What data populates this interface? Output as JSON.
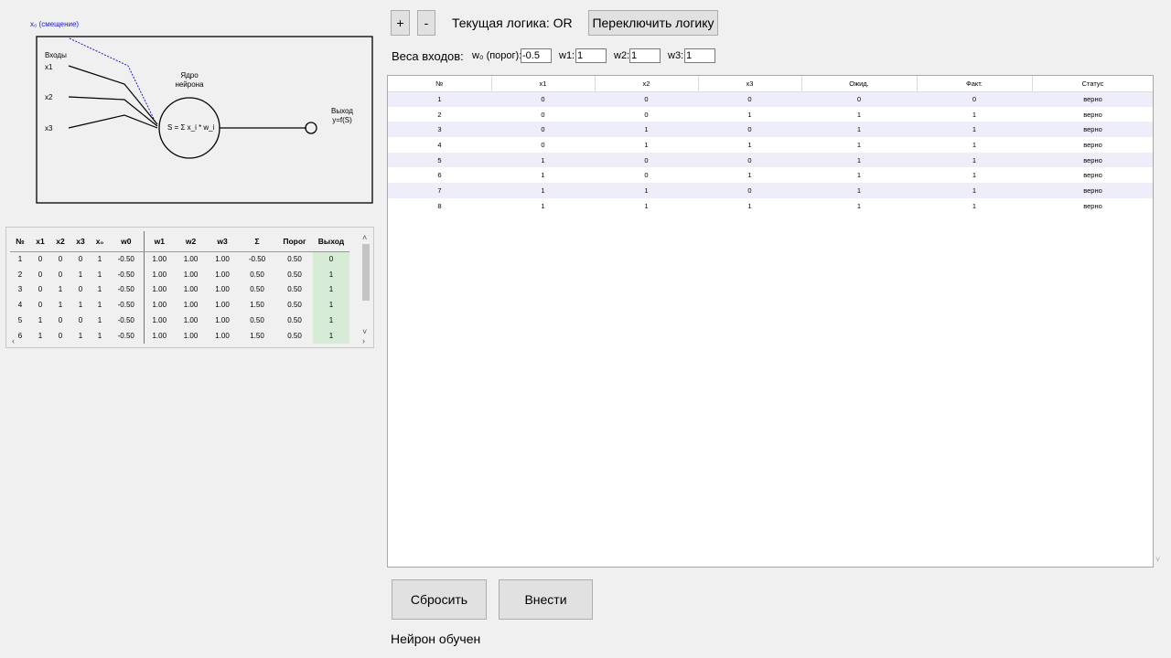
{
  "diagram": {
    "bias_label": "x₀ (смещение)",
    "inputs_label": "Входы",
    "input_names": [
      "x1",
      "x2",
      "x3"
    ],
    "core_label_line1": "Ядро",
    "core_label_line2": "нейрона",
    "sum_formula": "S = Σ x_i * w_i",
    "output_label_line1": "Выход",
    "output_label_line2": "y=f(S)"
  },
  "calc_table": {
    "headers": [
      "№",
      "x1",
      "x2",
      "x3",
      "x₀",
      "w0",
      "w1",
      "w2",
      "w3",
      "Σ",
      "Порог",
      "Выход"
    ],
    "rows": [
      [
        "1",
        "0",
        "0",
        "0",
        "1",
        "-0.50",
        "1.00",
        "1.00",
        "1.00",
        "-0.50",
        "0.50",
        "0"
      ],
      [
        "2",
        "0",
        "0",
        "1",
        "1",
        "-0.50",
        "1.00",
        "1.00",
        "1.00",
        "0.50",
        "0.50",
        "1"
      ],
      [
        "3",
        "0",
        "1",
        "0",
        "1",
        "-0.50",
        "1.00",
        "1.00",
        "1.00",
        "0.50",
        "0.50",
        "1"
      ],
      [
        "4",
        "0",
        "1",
        "1",
        "1",
        "-0.50",
        "1.00",
        "1.00",
        "1.00",
        "1.50",
        "0.50",
        "1"
      ],
      [
        "5",
        "1",
        "0",
        "0",
        "1",
        "-0.50",
        "1.00",
        "1.00",
        "1.00",
        "0.50",
        "0.50",
        "1"
      ],
      [
        "6",
        "1",
        "0",
        "1",
        "1",
        "-0.50",
        "1.00",
        "1.00",
        "1.00",
        "1.50",
        "0.50",
        "1"
      ]
    ],
    "output_bg": "#d6ecd6"
  },
  "toolbar": {
    "plus_label": "+",
    "minus_label": "-",
    "logic_label": "Текущая логика: OR",
    "switch_label": "Переключить логику"
  },
  "weights": {
    "title": "Веса входов:",
    "w0_label": "w₀ (порог):",
    "w0_value": "-0.5",
    "w1_label": "w1:",
    "w1_value": "1",
    "w2_label": "w2:",
    "w2_value": "1",
    "w3_label": "w3:",
    "w3_value": "1"
  },
  "truth_table": {
    "headers": [
      "№",
      "x1",
      "x2",
      "x3",
      "Ожид.",
      "Факт.",
      "Статус"
    ],
    "rows": [
      [
        "1",
        "0",
        "0",
        "0",
        "0",
        "0",
        "верно"
      ],
      [
        "2",
        "0",
        "0",
        "1",
        "1",
        "1",
        "верно"
      ],
      [
        "3",
        "0",
        "1",
        "0",
        "1",
        "1",
        "верно"
      ],
      [
        "4",
        "0",
        "1",
        "1",
        "1",
        "1",
        "верно"
      ],
      [
        "5",
        "1",
        "0",
        "0",
        "1",
        "1",
        "верно"
      ],
      [
        "6",
        "1",
        "0",
        "1",
        "1",
        "1",
        "верно"
      ],
      [
        "7",
        "1",
        "1",
        "0",
        "1",
        "1",
        "верно"
      ],
      [
        "8",
        "1",
        "1",
        "1",
        "1",
        "1",
        "верно"
      ]
    ],
    "alt_row_bg": "#eeeefa"
  },
  "actions": {
    "reset_label": "Сбросить",
    "apply_label": "Внести"
  },
  "status": {
    "text": "Нейрон обучен"
  },
  "colors": {
    "window_bg": "#f0f0f0",
    "bias_line": "#1a1acc"
  }
}
